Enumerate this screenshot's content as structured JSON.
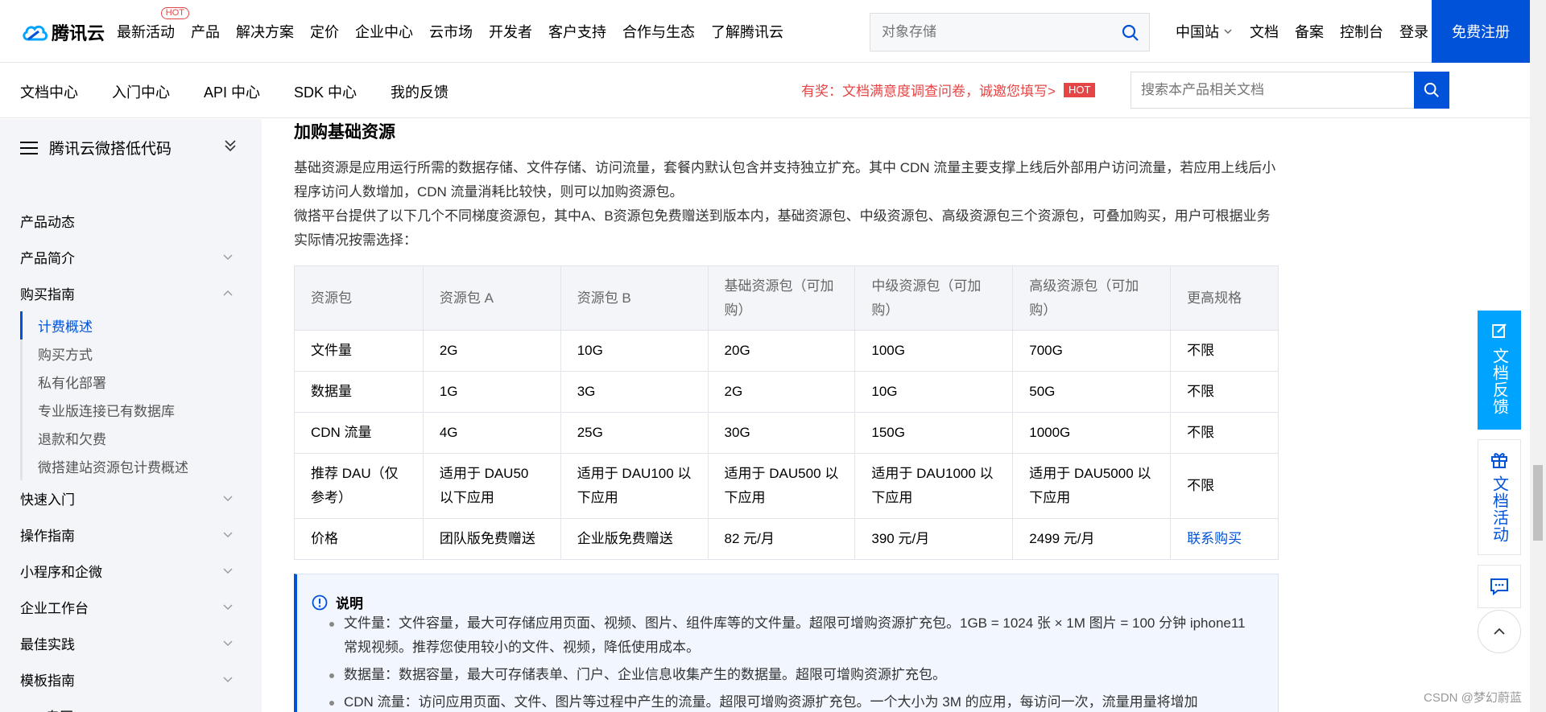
{
  "header": {
    "brand": "腾讯云",
    "nav": [
      {
        "label": "最新活动",
        "badge": "HOT"
      },
      {
        "label": "产品"
      },
      {
        "label": "解决方案"
      },
      {
        "label": "定价"
      },
      {
        "label": "企业中心"
      },
      {
        "label": "云市场"
      },
      {
        "label": "开发者"
      },
      {
        "label": "客户支持"
      },
      {
        "label": "合作与生态"
      },
      {
        "label": "了解腾讯云"
      }
    ],
    "search_placeholder": "对象存储",
    "right": {
      "region": "中国站",
      "docs": "文档",
      "beian": "备案",
      "console": "控制台",
      "login": "登录"
    },
    "signup": "免费注册"
  },
  "subnav": {
    "tabs": [
      "文档中心",
      "入门中心",
      "API 中心",
      "SDK 中心",
      "我的反馈"
    ],
    "promo": "有奖：文档满意度调查问卷，诚邀您填写>",
    "promo_badge": "HOT",
    "search_placeholder": "搜索本产品相关文档"
  },
  "sidebar": {
    "title": "腾讯云微搭低代码",
    "items_top": [
      "产品动态",
      "产品简介",
      "购买指南"
    ],
    "sub_items": [
      "计费概述",
      "购买方式",
      "私有化部署",
      "专业版连接已有数据库",
      "退款和欠费",
      "微搭建站资源包计费概述"
    ],
    "items_bottom": [
      "快速入门",
      "操作指南",
      "小程序和企微",
      "企业工作台",
      "最佳实践",
      "模板指南",
      "API 专区"
    ]
  },
  "content": {
    "heading": "加购基础资源",
    "para1": "基础资源是应用运行所需的数据存储、文件存储、访问流量，套餐内默认包含并支持独立扩充。其中 CDN 流量主要支撑上线后外部用户访问流量，若应用上线后小程序访问人数增加，CDN 流量消耗比较快，则可以加购资源包。",
    "para2": "微搭平台提供了以下几个不同梯度资源包，其中A、B资源包免费赠送到版本内，基础资源包、中级资源包、高级资源包三个资源包，可叠加购买，用户可根据业务实际情况按需选择：",
    "table": {
      "headers": [
        "资源包",
        "资源包 A",
        "资源包 B",
        "基础资源包（可加购）",
        "中级资源包（可加购）",
        "高级资源包（可加购）",
        "更高规格"
      ],
      "rows": [
        [
          "文件量",
          "2G",
          "10G",
          "20G",
          "100G",
          "700G",
          "不限"
        ],
        [
          "数据量",
          "1G",
          "3G",
          "2G",
          "10G",
          "50G",
          "不限"
        ],
        [
          "CDN 流量",
          "4G",
          "25G",
          "30G",
          "150G",
          "1000G",
          "不限"
        ],
        [
          "推荐 DAU（仅参考）",
          "适用于 DAU50 以下应用",
          "适用于 DAU100 以下应用",
          "适用于 DAU500 以下应用",
          "适用于 DAU1000 以下应用",
          "适用于 DAU5000 以下应用",
          "不限"
        ],
        [
          "价格",
          "团队版免费赠送",
          "企业版免费赠送",
          "82 元/月",
          "390 元/月",
          "2499 元/月",
          "联系购买"
        ]
      ]
    },
    "note": {
      "title": "说明",
      "items": [
        "文件量：文件容量，最大可存储应用页面、视频、图片、组件库等的文件量。超限可增购资源扩充包。1GB = 1024 张 × 1M 图片 = 100 分钟 iphone11 常规视频。推荐您使用较小的文件、视频，降低使用成本。",
        "数据量：数据容量，最大可存储表单、门户、企业信息收集产生的数据量。超限可增购资源扩充包。",
        "CDN 流量：访问应用页面、文件、图片等过程中产生的流量。超限可增购资源扩充包。一个大小为 3M 的应用，每访问一次，流量用量将增加"
      ]
    }
  },
  "float": {
    "feedback": "文档反馈",
    "activity": "文档活动"
  },
  "watermark": "CSDN @梦幻蔚蓝",
  "colors": {
    "primary": "#0052d9",
    "accent": "#00a4ff",
    "hot": "#e54545"
  }
}
